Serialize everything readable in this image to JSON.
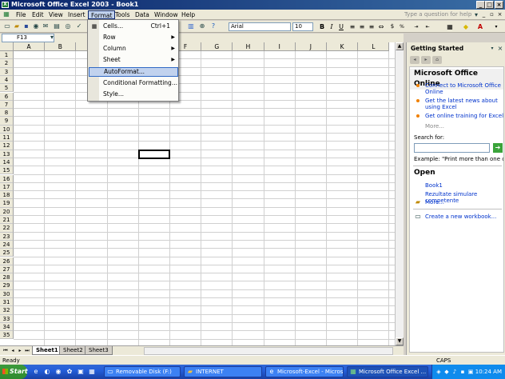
{
  "window": {
    "title": "Microsoft Office Excel 2003 - Book1",
    "ask_placeholder": "Type a question for help"
  },
  "menubar": {
    "items": [
      "File",
      "Edit",
      "View",
      "Insert",
      "Format",
      "Tools",
      "Data",
      "Window",
      "Help"
    ],
    "active": "Format"
  },
  "toolbar": {
    "font": "Arial",
    "size": "10"
  },
  "formula": {
    "namebox": "F13"
  },
  "format_menu": {
    "items": [
      {
        "label": "Cells...",
        "shortcut": "Ctrl+1",
        "submenu": false
      },
      {
        "label": "Row",
        "shortcut": "",
        "submenu": true
      },
      {
        "label": "Column",
        "shortcut": "",
        "submenu": true
      },
      {
        "label": "Sheet",
        "shortcut": "",
        "submenu": true
      },
      {
        "label": "AutoFormat...",
        "shortcut": "",
        "submenu": false,
        "highlighted": true
      },
      {
        "label": "Conditional Formatting...",
        "shortcut": "",
        "submenu": false
      },
      {
        "label": "Style...",
        "shortcut": "",
        "submenu": false
      }
    ]
  },
  "grid": {
    "columns": [
      "A",
      "B",
      "C",
      "D",
      "E",
      "F",
      "G",
      "H",
      "I",
      "J",
      "K",
      "L"
    ],
    "rows": [
      "1",
      "2",
      "3",
      "4",
      "5",
      "6",
      "7",
      "8",
      "9",
      "10",
      "11",
      "12",
      "13",
      "14",
      "15",
      "16",
      "17",
      "18",
      "19",
      "20",
      "21",
      "22",
      "23",
      "24",
      "25",
      "26",
      "27",
      "28",
      "29",
      "30",
      "31",
      "32",
      "33",
      "34",
      "35"
    ],
    "active_cell": "F13"
  },
  "sheets": {
    "tabs": [
      "Sheet1",
      "Sheet2",
      "Sheet3"
    ],
    "active": "Sheet1"
  },
  "statusbar": {
    "left": "Ready",
    "caps": "CAPS"
  },
  "taskpane": {
    "title": "Getting Started",
    "online_heading": "Microsoft Office Online",
    "online_links": [
      "Connect to Microsoft Office Online",
      "Get the latest news about using Excel",
      "Get online training for Excel"
    ],
    "more_label": "More...",
    "search_label": "Search for:",
    "example_text": "Example:  \"Print more than one copy\"",
    "open_heading": "Open",
    "open_files": [
      "Book1",
      "Rezultate simulare competente"
    ],
    "open_more": "More...",
    "new_workbook": "Create a new workbook..."
  },
  "taskbar": {
    "start": "Start",
    "tasks": [
      {
        "label": "Removable Disk (F:)",
        "icon": "drive-icon"
      },
      {
        "label": "INTERNET",
        "icon": "folder-icon"
      },
      {
        "label": "Microsoft-Excel - Microso...",
        "icon": "ie-icon"
      },
      {
        "label": "Microsoft Office Excel ...",
        "icon": "excel-icon",
        "active": true
      }
    ],
    "clock": "10:24 AM"
  }
}
